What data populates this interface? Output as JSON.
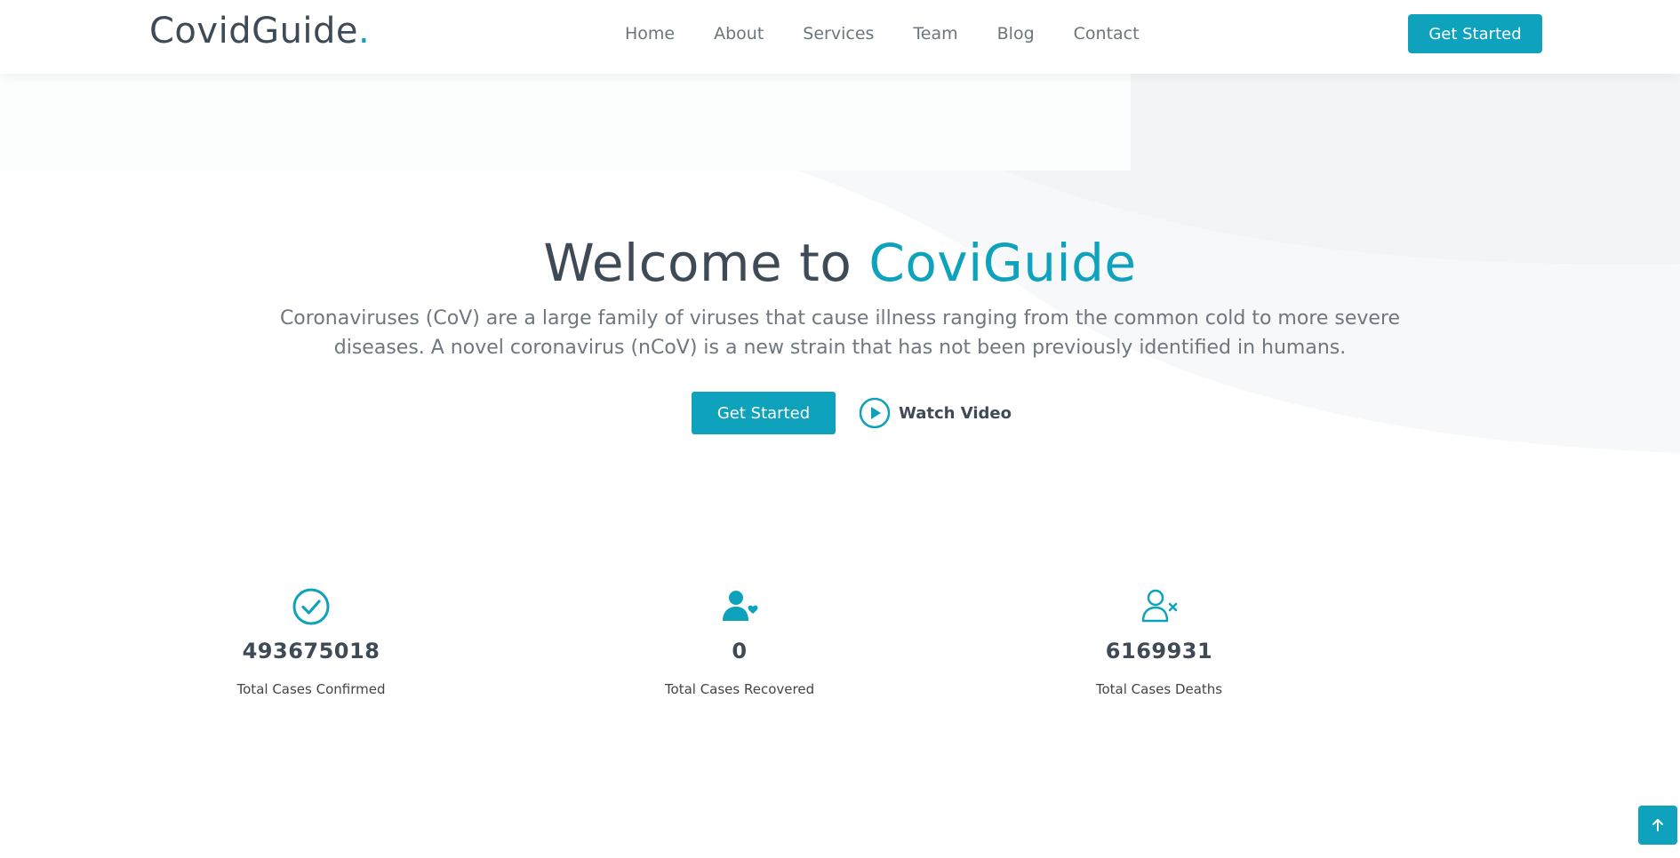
{
  "header": {
    "logo_text": "CovidGuide",
    "logo_dot": ".",
    "nav": [
      "Home",
      "About",
      "Services",
      "Team",
      "Blog",
      "Contact"
    ],
    "cta_label": "Get Started"
  },
  "hero": {
    "title_prefix": "Welcome to ",
    "title_accent": "CoviGuide",
    "subtitle": "Coronaviruses (CoV) are a large family of viruses that cause illness ranging from the common cold to more severe diseases. A novel coronavirus (nCoV) is a new strain that has not been previously identified in humans.",
    "cta_label": "Get Started",
    "watch_label": "Watch Video"
  },
  "stats": [
    {
      "icon": "check-circle-icon",
      "value": "493675018",
      "label": "Total Cases Confirmed"
    },
    {
      "icon": "person-heart-icon",
      "value": "0",
      "label": "Total Cases Recovered"
    },
    {
      "icon": "person-x-icon",
      "value": "6169931",
      "label": "Total Cases Deaths"
    }
  ],
  "colors": {
    "accent": "#0ea2bd",
    "heading": "#3f4a57",
    "body_text": "#6f7680"
  },
  "back_to_top_icon": "arrow-up-icon"
}
